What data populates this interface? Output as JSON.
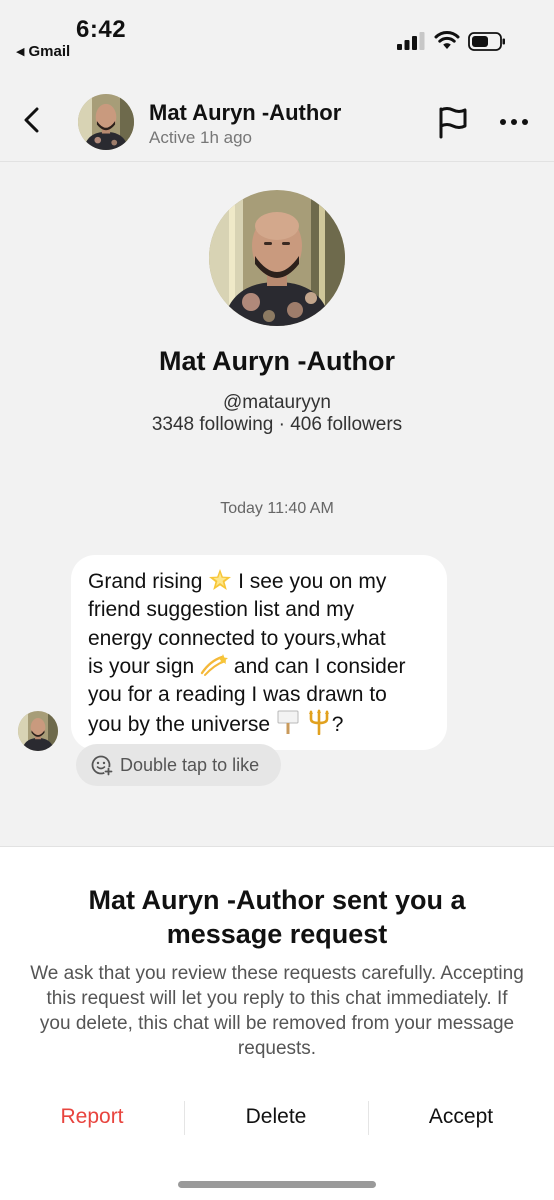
{
  "status_bar": {
    "time": "6:42",
    "back_app": "Gmail"
  },
  "header": {
    "name": "Mat Auryn -Author",
    "status": "Active 1h ago"
  },
  "profile": {
    "name": "Mat Auryn -Author",
    "handle": "@matauryyn",
    "stats": "3348 following · 406 followers"
  },
  "chat": {
    "timestamp": "Today 11:40 AM",
    "message_lines": [
      "Grand rising",
      "I see you on my",
      "friend suggestion list and my",
      "energy connected to yours,what",
      "is your sign",
      "and can I consider",
      "you for a reading I was drawn to",
      "you by the universe",
      "?"
    ],
    "emojis": [
      "glowing-star-emoji",
      "dizzy-emoji",
      "placard-emoji",
      "trident-emoji"
    ],
    "like_hint": "Double tap to like"
  },
  "request_sheet": {
    "title": "Mat Auryn -Author sent you a message request",
    "body": "We ask that you review these requests carefully. Accepting this request will let you reply to this chat immediately. If you delete, this chat will be removed from your message requests.",
    "report_label": "Report",
    "delete_label": "Delete",
    "accept_label": "Accept"
  },
  "colors": {
    "background": "#f2f2f2",
    "report": "#e8443e",
    "bubble": "#ffffff",
    "sheet": "#ffffff"
  }
}
